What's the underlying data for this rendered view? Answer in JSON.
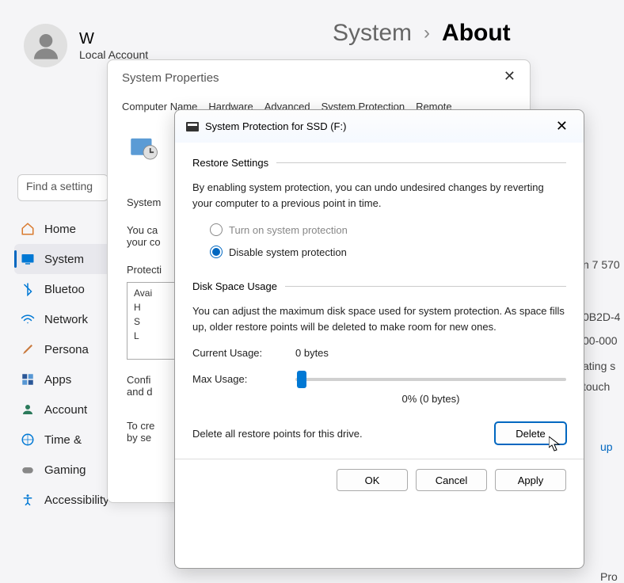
{
  "user": {
    "name": "W",
    "type": "Local Account"
  },
  "breadcrumb": {
    "system": "System",
    "about": "About"
  },
  "search": {
    "placeholder": "Find a setting"
  },
  "sidebar": {
    "items": [
      {
        "label": "Home"
      },
      {
        "label": "System"
      },
      {
        "label": "Bluetoo"
      },
      {
        "label": "Network"
      },
      {
        "label": "Persona"
      },
      {
        "label": "Apps"
      },
      {
        "label": "Account"
      },
      {
        "label": "Time &"
      },
      {
        "label": "Gaming"
      },
      {
        "label": "Accessibility"
      }
    ]
  },
  "sysprops": {
    "title": "System Properties",
    "tabs": [
      "Computer Name",
      "Hardware",
      "Advanced",
      "System Protection",
      "Remote"
    ],
    "desc1": "System",
    "desc2": "You ca",
    "desc3": "your co",
    "section_label": "Protecti",
    "list_header": "Avai",
    "list_rows": [
      "H",
      "S",
      "L"
    ],
    "confi_text": "Confi",
    "and_d_text": "and d",
    "tocre_text": "To cre",
    "byse_text": "by se"
  },
  "protection": {
    "title": "System Protection for SSD (F:)",
    "restore": {
      "header": "Restore Settings",
      "desc": "By enabling system protection, you can undo undesired changes by reverting your computer to a previous point in time.",
      "turn_on": "Turn on system protection",
      "disable": "Disable system protection"
    },
    "disk": {
      "header": "Disk Space Usage",
      "desc": "You can adjust the maximum disk space used for system protection. As space fills up, older restore points will be deleted to make room for new ones.",
      "current_label": "Current Usage:",
      "current_value": "0 bytes",
      "max_label": "Max Usage:",
      "max_value": "0% (0 bytes)",
      "delete_text": "Delete all restore points for this drive.",
      "delete_btn": "Delete"
    },
    "buttons": {
      "ok": "OK",
      "cancel": "Cancel",
      "apply": "Apply"
    }
  },
  "bg_fragments": {
    "a": "n 7 570",
    "b": "0B2D-4",
    "c": "00-000",
    "d": "ating s",
    "e": "touch",
    "f": "up",
    "g": "Pro"
  },
  "colors": {
    "accent": "#0067c0"
  }
}
